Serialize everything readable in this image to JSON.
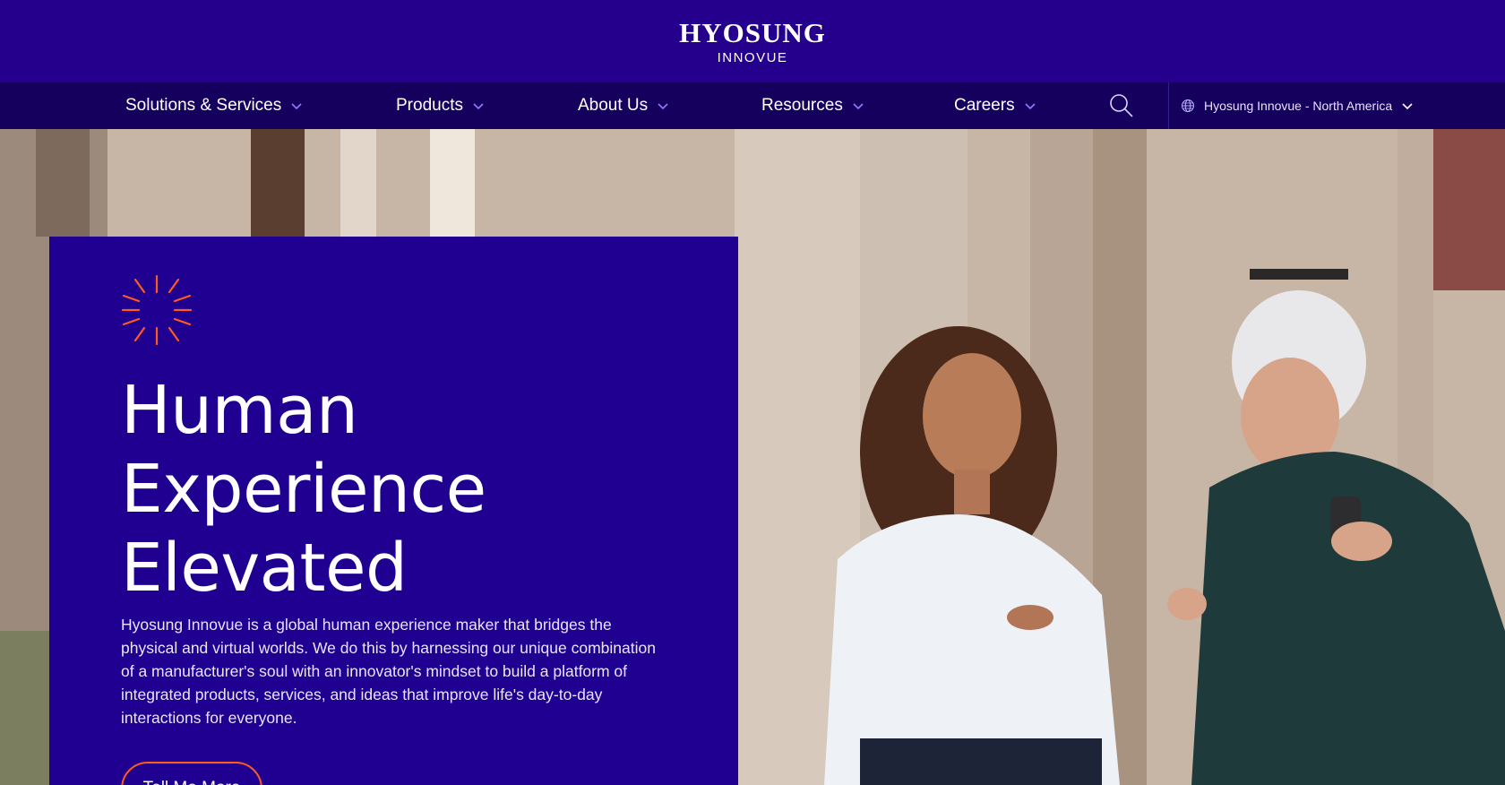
{
  "brand": {
    "logo_main": "HYOSUNG",
    "logo_sub": "INNOVUE"
  },
  "nav": {
    "items": [
      {
        "label": "Solutions & Services",
        "icon": "chevron-down-icon"
      },
      {
        "label": "Products",
        "icon": "chevron-down-icon"
      },
      {
        "label": "About Us",
        "icon": "chevron-down-icon"
      },
      {
        "label": "Resources",
        "icon": "chevron-down-icon"
      },
      {
        "label": "Careers",
        "icon": "chevron-down-icon"
      }
    ],
    "search_icon": "search-icon",
    "region_label": "Hyosung Innovue - North America",
    "region_icon": "globe-icon"
  },
  "hero": {
    "spark_icon": "sparkle-icon",
    "title_lines": [
      "Human",
      "Experience",
      "Elevated"
    ],
    "body": "Hyosung Innovue is a global human experience maker that bridges the physical and virtual worlds. We do this by harnessing our unique combination of a manufacturer's soul with an innovator's mindset to build a platform of integrated products, services, and ideas that improve life's day-to-day interactions for everyone.",
    "cta_label": "Tell Me More"
  },
  "colors": {
    "brand_purple": "#24008d",
    "nav_dark": "#16005e",
    "card_purple": "#1f0090",
    "accent_orange": "#ff5a1f",
    "chevron_violet": "#8f7bff"
  }
}
